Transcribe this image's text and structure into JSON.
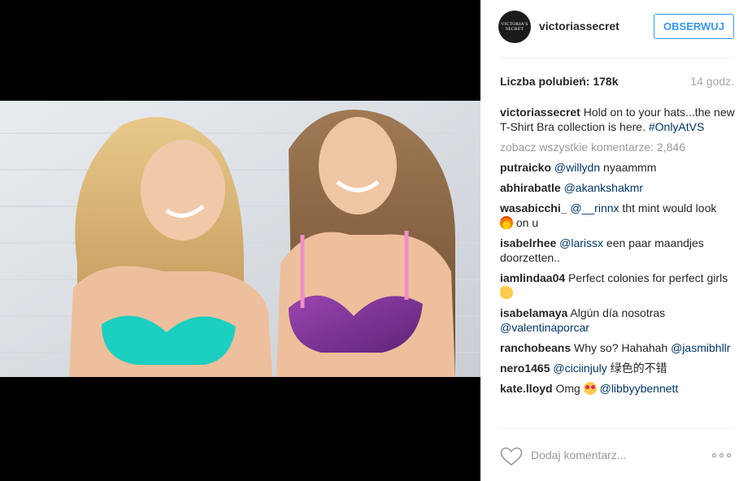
{
  "post": {
    "media_alt": "Two smiling women in colorful bras against a white brick wall"
  },
  "header": {
    "avatar_text": "VICTORIA'S SECRET",
    "username": "victoriassecret",
    "follow_label": "OBSERWUJ"
  },
  "stats": {
    "likes": "Liczba polubień: 178k",
    "timestamp": "14 godz."
  },
  "caption": {
    "username": "victoriassecret",
    "text": " Hold on to your hats...the new T-Shirt Bra collection is here. ",
    "hashtag": "#OnlyAtVS"
  },
  "view_all_comments": "zobacz wszystkie komentarze: 2,846",
  "comments": [
    {
      "username": "putraicko",
      "mention": "@willydn",
      "text": " nyaammm",
      "emoji": ""
    },
    {
      "username": "abhirabatle",
      "mention": "@akankshakmr",
      "text": "",
      "emoji": ""
    },
    {
      "username": "wasabicchi_",
      "mention": "@__rinnx",
      "text": " tht mint would look ",
      "emoji": "fire-emoji",
      "after": " on u"
    },
    {
      "username": "isabelrhee",
      "mention": "@larissx",
      "text": " een paar maandjes doorzetten..",
      "emoji": ""
    },
    {
      "username": "iamlindaa04",
      "mention": "",
      "text": " Perfect colonies for perfect girls ",
      "emoji": "clap-emoji"
    },
    {
      "username": "isabelamaya",
      "mention": "",
      "text": " Algún día nosotras ",
      "mention_after": "@valentinaporcar"
    },
    {
      "username": "ranchobeans",
      "mention": "",
      "text": " Why so? Hahahah ",
      "mention_after": "@jasmibhllr"
    },
    {
      "username": "nero1465",
      "mention": "@ciciinjuly",
      "text": " 绿色的不错",
      "emoji": ""
    },
    {
      "username": "kate.lloyd",
      "mention": "",
      "text": " Omg ",
      "emoji": "heart-eyes-emoji",
      "mention_after": "@libbyybennett"
    }
  ],
  "footer": {
    "comment_placeholder": "Dodaj komentarz..."
  },
  "colors": {
    "accent": "#3897f0",
    "link": "#003569",
    "muted": "#999999"
  }
}
